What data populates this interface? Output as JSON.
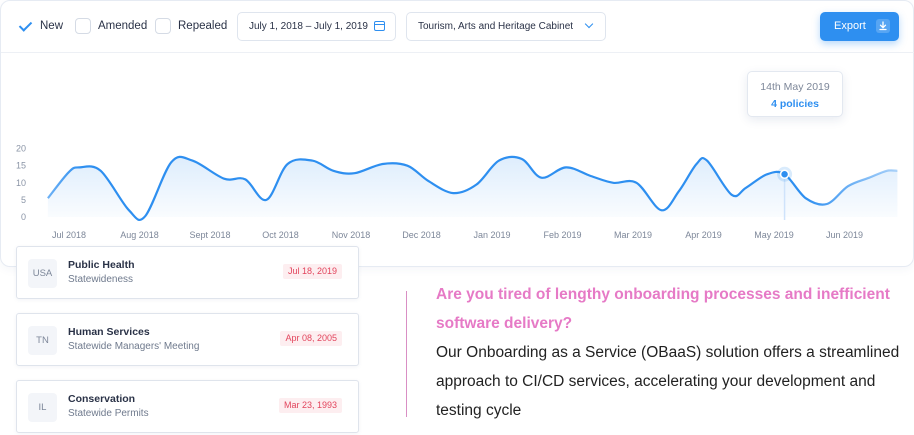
{
  "filters": {
    "new": {
      "label": "New",
      "checked": true
    },
    "amended": {
      "label": "Amended",
      "checked": false
    },
    "repealed": {
      "label": "Repealed",
      "checked": false
    }
  },
  "date_range": "July 1, 2018 – July 1, 2019",
  "cabinet_select": "Tourism, Arts and Heritage Cabinet",
  "export_label": "Export",
  "icons": {
    "calendar": "calendar-icon",
    "dropdown": "chevron-down-icon",
    "export": "download-icon",
    "checkbox": "checkmark-icon"
  },
  "colors": {
    "accent": "#2e8ff0",
    "date_badge_bg": "#fdeef0",
    "date_badge_text": "#e2445c",
    "headline": "#e67ac6",
    "divider": "#d98fc4"
  },
  "tooltip": {
    "date": "14th May 2019",
    "value": "4 policies"
  },
  "chart_data": {
    "type": "area",
    "title": "",
    "xlabel": "",
    "ylabel": "",
    "ylim": [
      0,
      20
    ],
    "yticks": [
      "0",
      "5",
      "10",
      "15",
      "20"
    ],
    "xticks": [
      "Jul 2018",
      "Aug 2018",
      "Sept 2018",
      "Oct 2018",
      "Nov 2018",
      "Dec 2018",
      "Jan 2019",
      "Feb 2019",
      "Mar 2019",
      "Apr 2019",
      "May 2019",
      "Jun 2019"
    ],
    "grid": false,
    "legend": "none",
    "x": [
      -0.3,
      0.0,
      0.15,
      0.45,
      0.85,
      1.08,
      1.45,
      1.75,
      2.2,
      2.5,
      2.8,
      3.1,
      3.45,
      3.75,
      4.05,
      4.45,
      4.8,
      5.1,
      5.45,
      5.78,
      6.1,
      6.42,
      6.7,
      7.05,
      7.4,
      7.72,
      8.05,
      8.4,
      8.65,
      8.9,
      9.05,
      9.4,
      9.6,
      9.9,
      10.15,
      10.45,
      10.75,
      11.05,
      11.35,
      11.6,
      11.75
    ],
    "values": [
      5.5,
      13.2,
      14.5,
      13.5,
      2.0,
      0.2,
      16.0,
      16.5,
      11.2,
      11.0,
      5.0,
      15.5,
      16.5,
      13.5,
      12.8,
      15.5,
      15.0,
      10.5,
      7.0,
      9.5,
      16.5,
      17.0,
      11.5,
      14.5,
      12.0,
      10.0,
      10.0,
      2.0,
      7.5,
      15.5,
      16.5,
      6.5,
      8.5,
      12.5,
      12.5,
      5.5,
      3.8,
      9.0,
      11.5,
      13.5,
      13.5
    ],
    "highlight": {
      "label": "14th May 2019",
      "x": 10.15,
      "value": 12.5,
      "policies": 4
    }
  },
  "policies": [
    {
      "code": "USA",
      "title": "Public Health",
      "subtitle": "Statewideness",
      "date": "Jul 18, 2019"
    },
    {
      "code": "TN",
      "title": "Human Services",
      "subtitle": "Statewide Managers' Meeting",
      "date": "Apr 08, 2005"
    },
    {
      "code": "IL",
      "title": "Conservation",
      "subtitle": "Statewide Permits",
      "date": "Mar 23, 1993"
    }
  ],
  "promo": {
    "headline": "Are you tired of lengthy onboarding processes and inefficient software delivery?",
    "body": "Our Onboarding as a Service (OBaaS) solution offers a streamlined approach to  CI/CD services, accelerating your development and testing cycle"
  }
}
